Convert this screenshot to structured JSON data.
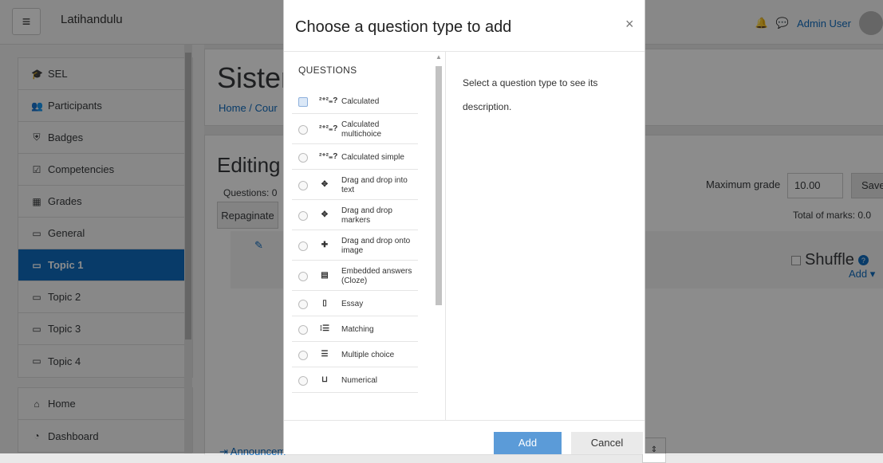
{
  "navbar": {
    "site_name": "Latihandulu",
    "user_name": "Admin User",
    "menu_icon": "hamburger-icon",
    "notification_icon": "bell-icon",
    "message_icon": "chat-icon"
  },
  "drawer": {
    "items": [
      {
        "label": "SEL",
        "icon": "graduation-cap-icon"
      },
      {
        "label": "Participants",
        "icon": "users-icon"
      },
      {
        "label": "Badges",
        "icon": "shield-icon"
      },
      {
        "label": "Competencies",
        "icon": "checkbox-icon"
      },
      {
        "label": "Grades",
        "icon": "table-icon"
      },
      {
        "label": "General",
        "icon": "folder-icon"
      },
      {
        "label": "Topic 1",
        "icon": "folder-icon",
        "active": true
      },
      {
        "label": "Topic 2",
        "icon": "folder-icon"
      },
      {
        "label": "Topic 3",
        "icon": "folder-icon"
      },
      {
        "label": "Topic 4",
        "icon": "folder-icon"
      }
    ],
    "items2": [
      {
        "label": "Home",
        "icon": "home-icon"
      },
      {
        "label": "Dashboard",
        "icon": "dashboard-icon"
      }
    ]
  },
  "page": {
    "title": "Sistem",
    "breadcrumb": "Home / Cour",
    "editing_title": "Editing",
    "questions_count": "Questions: 0",
    "repaginate": "Repaginate",
    "max_grade_label": "Maximum grade",
    "max_grade_value": "10.00",
    "save_label": "Save",
    "total_marks": "Total of marks: 0.0",
    "shuffle": "Shuffle",
    "add_menu": "Add ▾",
    "announcements": "⇥ Announcem"
  },
  "modal": {
    "title": "Choose a question type to add",
    "close": "×",
    "heading": "QUESTIONS",
    "description": "Select a question type to see its description.",
    "add_label": "Add",
    "cancel_label": "Cancel",
    "options": [
      {
        "label": "Calculated",
        "icon": "calculated-icon",
        "glyph": "²⁺²₌?",
        "selected": true
      },
      {
        "label": "Calculated multichoice",
        "icon": "calculated-multichoice-icon",
        "glyph": "²⁺²₌?"
      },
      {
        "label": "Calculated simple",
        "icon": "calculated-simple-icon",
        "glyph": "²⁺²₌?"
      },
      {
        "label": "Drag and drop into text",
        "icon": "drag-drop-text-icon",
        "glyph": "✥"
      },
      {
        "label": "Drag and drop markers",
        "icon": "drag-drop-markers-icon",
        "glyph": "✥"
      },
      {
        "label": "Drag and drop onto image",
        "icon": "drag-drop-image-icon",
        "glyph": "✚"
      },
      {
        "label": "Embedded answers (Cloze)",
        "icon": "cloze-icon",
        "glyph": "▤"
      },
      {
        "label": "Essay",
        "icon": "essay-icon",
        "glyph": "▯"
      },
      {
        "label": "Matching",
        "icon": "matching-icon",
        "glyph": "⁝☰"
      },
      {
        "label": "Multiple choice",
        "icon": "multiple-choice-icon",
        "glyph": "☰"
      },
      {
        "label": "Numerical",
        "icon": "numerical-icon",
        "glyph": "⊔"
      }
    ]
  }
}
